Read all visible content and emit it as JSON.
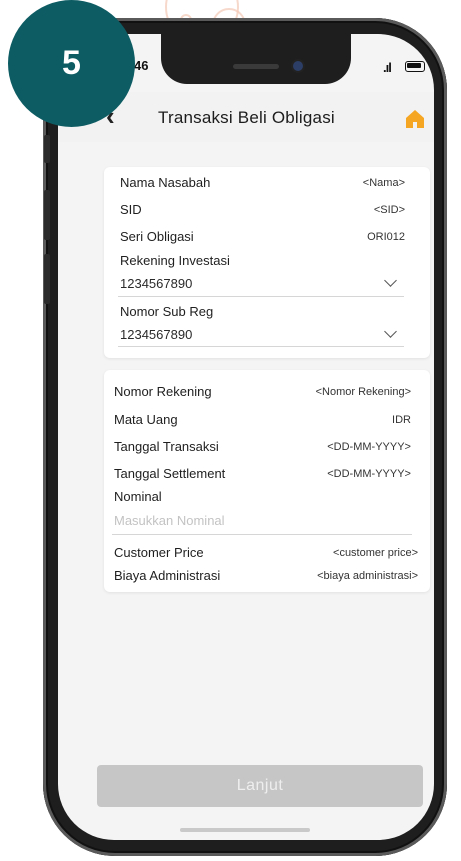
{
  "step_badge": "5",
  "status_bar": {
    "time": "46",
    "signal": ".ıl"
  },
  "header": {
    "title": "Transaksi Beli Obligasi"
  },
  "card1": {
    "rows": [
      {
        "label": "Nama Nasabah",
        "value": "<Nama>"
      },
      {
        "label": "SID",
        "value": "<SID>"
      },
      {
        "label": "Seri Obligasi",
        "value": "ORI012"
      }
    ],
    "rekening_investasi": {
      "label": "Rekening Investasi",
      "value": "1234567890"
    },
    "nomor_sub_reg": {
      "label": "Nomor Sub Reg",
      "value": "1234567890"
    }
  },
  "card2": {
    "rows": [
      {
        "label": "Nomor Rekening",
        "value": "<Nomor Rekening>"
      },
      {
        "label": "Mata Uang",
        "value": "IDR"
      },
      {
        "label": "Tanggal Transaksi",
        "value": "<DD-MM-YYYY>"
      },
      {
        "label": "Tanggal Settlement",
        "value": "<DD-MM-YYYY>"
      }
    ],
    "nominal": {
      "label": "Nominal",
      "placeholder": "Masukkan Nominal"
    },
    "rows_bottom": [
      {
        "label": "Customer Price",
        "value": "<customer price>"
      },
      {
        "label": "Biaya Administrasi",
        "value": "<biaya administrasi>"
      }
    ]
  },
  "footer": {
    "button_label": "Lanjut"
  },
  "colors": {
    "badge": "#0d5c63",
    "home_icon": "#f5a623",
    "button_disabled": "#c6c6c6"
  }
}
